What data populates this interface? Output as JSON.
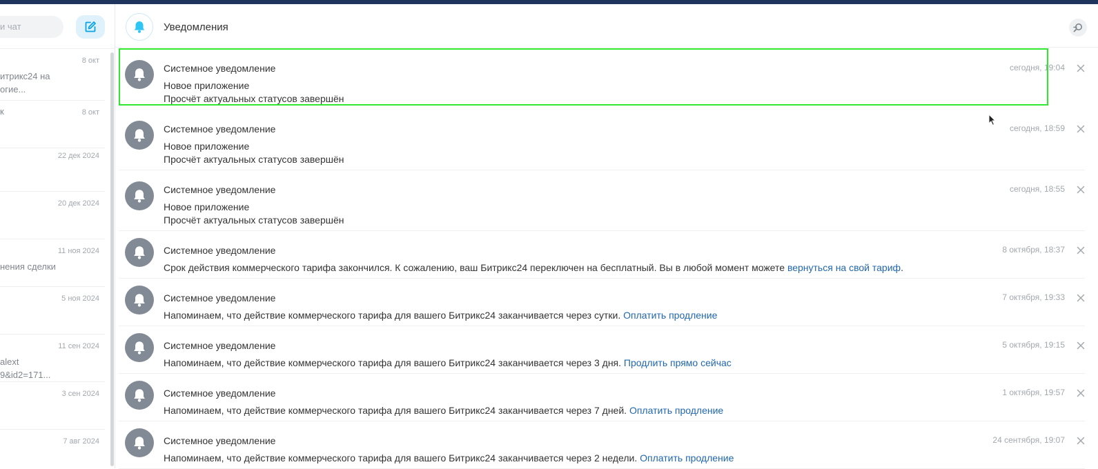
{
  "sidebar": {
    "search_placeholder": "и чат",
    "chats": [
      {
        "date": "8 окт",
        "preview": [
          "итрикс24 на",
          "огие..."
        ]
      },
      {
        "date": "8 окт",
        "preview": [
          "к"
        ]
      },
      {
        "date": "22 дек 2024",
        "preview": []
      },
      {
        "date": "20 дек 2024",
        "preview": []
      },
      {
        "date": "11 ноя 2024",
        "preview": [
          "нения сделки"
        ]
      },
      {
        "date": "5 ноя 2024",
        "preview": []
      },
      {
        "date": "11 сен 2024",
        "preview": [
          "alext",
          "9&id2=171..."
        ]
      },
      {
        "date": "3 сен 2024",
        "preview": []
      },
      {
        "date": "7 авг 2024",
        "preview": []
      }
    ]
  },
  "header": {
    "title": "Уведомления"
  },
  "notifications": [
    {
      "title": "Системное уведомление",
      "time": "сегодня, 19:04",
      "lines": [
        {
          "text": "Новое приложение",
          "link": ""
        },
        {
          "text": "Просчёт актуальных статусов завершён",
          "link": ""
        }
      ],
      "selected": true
    },
    {
      "title": "Системное уведомление",
      "time": "сегодня, 18:59",
      "lines": [
        {
          "text": "Новое приложение",
          "link": ""
        },
        {
          "text": "Просчёт актуальных статусов завершён",
          "link": ""
        }
      ]
    },
    {
      "title": "Системное уведомление",
      "time": "сегодня, 18:55",
      "lines": [
        {
          "text": "Новое приложение",
          "link": ""
        },
        {
          "text": "Просчёт актуальных статусов завершён",
          "link": ""
        }
      ]
    },
    {
      "title": "Системное уведомление",
      "time": "8 октября, 18:37",
      "lines": [
        {
          "text": "Срок действия коммерческого тарифа закончился. К сожалению, ваш Битрикс24 переключен на бесплатный. Вы в любой момент можете ",
          "link": "вернуться на свой тариф",
          "after": "."
        }
      ]
    },
    {
      "title": "Системное уведомление",
      "time": "7 октября, 19:33",
      "lines": [
        {
          "text": "Напоминаем, что действие коммерческого тарифа для вашего Битрикс24 заканчивается через сутки. ",
          "link": "Оплатить продление"
        }
      ]
    },
    {
      "title": "Системное уведомление",
      "time": "5 октября, 19:15",
      "lines": [
        {
          "text": "Напоминаем, что действие коммерческого тарифа для вашего Битрикс24 заканчивается через 3 дня. ",
          "link": "Продлить прямо сейчас"
        }
      ]
    },
    {
      "title": "Системное уведомление",
      "time": "1 октября, 19:57",
      "lines": [
        {
          "text": "Напоминаем, что действие коммерческого тарифа для вашего Битрикс24 заканчивается через 7 дней. ",
          "link": "Оплатить продление"
        }
      ]
    },
    {
      "title": "Системное уведомление",
      "time": "24 сентября, 19:07",
      "lines": [
        {
          "text": "Напоминаем, что действие коммерческого тарифа для вашего Битрикс24 заканчивается через 2 недели. ",
          "link": "Оплатить продление"
        }
      ]
    }
  ],
  "icons": {
    "compose": "edit-icon",
    "bell": "bell-icon",
    "search": "search-icon",
    "close": "close-icon"
  },
  "colors": {
    "accent": "#2fc6f6",
    "link": "#2067b0",
    "selection": "#2ee82e",
    "avatar_bg": "#828b95"
  }
}
